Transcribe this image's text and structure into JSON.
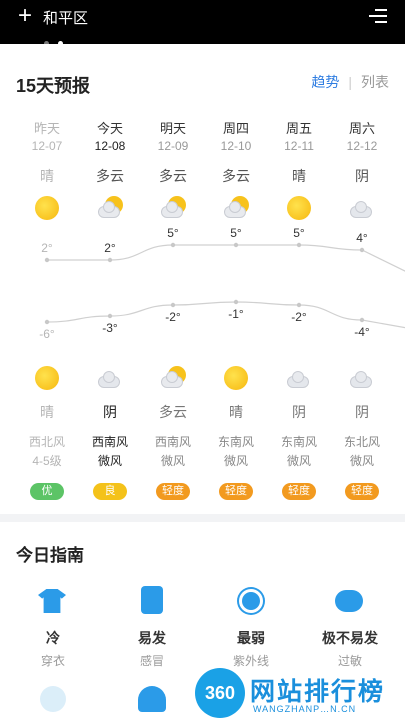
{
  "header": {
    "location": "和平区"
  },
  "forecast": {
    "title": "15天预报",
    "tabs": {
      "trend": "趋势",
      "separator": "|",
      "list": "列表"
    },
    "days": [
      {
        "name": "昨天",
        "date": "12-07",
        "day_cond": "晴",
        "night_cond": "晴",
        "high": "2°",
        "low": "-6°",
        "wind_dir": "西北风",
        "wind_level": "4-5级",
        "aqi": "优",
        "aqi_color": "#5cc466",
        "past": true,
        "day_icon": "sun",
        "night_icon": "sun"
      },
      {
        "name": "今天",
        "date": "12-08",
        "day_cond": "多云",
        "night_cond": "阴",
        "high": "2°",
        "low": "-3°",
        "wind_dir": "西南风",
        "wind_level": "微风",
        "aqi": "良",
        "aqi_color": "#f4c21a",
        "past": false,
        "day_icon": "partly-cloudy",
        "night_icon": "cloud"
      },
      {
        "name": "明天",
        "date": "12-09",
        "day_cond": "多云",
        "night_cond": "多云",
        "high": "5°",
        "low": "-2°",
        "wind_dir": "西南风",
        "wind_level": "微风",
        "aqi": "轻度",
        "aqi_color": "#f29a1f",
        "past": false,
        "day_icon": "partly-cloudy",
        "night_icon": "partly-cloudy"
      },
      {
        "name": "周四",
        "date": "12-10",
        "day_cond": "多云",
        "night_cond": "晴",
        "high": "5°",
        "low": "-1°",
        "wind_dir": "东南风",
        "wind_level": "微风",
        "aqi": "轻度",
        "aqi_color": "#f29a1f",
        "past": false,
        "day_icon": "partly-cloudy",
        "night_icon": "sun"
      },
      {
        "name": "周五",
        "date": "12-11",
        "day_cond": "晴",
        "night_cond": "阴",
        "high": "5°",
        "low": "-2°",
        "wind_dir": "东南风",
        "wind_level": "微风",
        "aqi": "轻度",
        "aqi_color": "#f29a1f",
        "past": false,
        "day_icon": "sun",
        "night_icon": "cloud"
      },
      {
        "name": "周六",
        "date": "12-12",
        "day_cond": "阴",
        "night_cond": "阴",
        "high": "4°",
        "low": "-4°",
        "wind_dir": "东北风",
        "wind_level": "微风",
        "aqi": "轻度",
        "aqi_color": "#f29a1f",
        "past": false,
        "day_icon": "cloud",
        "night_icon": "cloud"
      }
    ],
    "high_values": [
      2,
      2,
      5,
      5,
      5,
      4
    ],
    "low_values": [
      -6,
      -3,
      -2,
      -1,
      -2,
      -4
    ]
  },
  "guide": {
    "title": "今日指南",
    "items": [
      {
        "value": "冷",
        "label": "穿衣",
        "icon": "shirt-icon",
        "color": "#2b9be8"
      },
      {
        "value": "易发",
        "label": "感冒",
        "icon": "medicine-icon",
        "color": "#2b9be8"
      },
      {
        "value": "最弱",
        "label": "紫外线",
        "icon": "uv-icon",
        "color": "#2b9be8"
      },
      {
        "value": "极不易发",
        "label": "过敏",
        "icon": "mask-icon",
        "color": "#2b9be8"
      }
    ]
  },
  "watermark": {
    "main": "网站排行榜",
    "badge": "360",
    "sub": "WANGZHANP…N.CN"
  }
}
